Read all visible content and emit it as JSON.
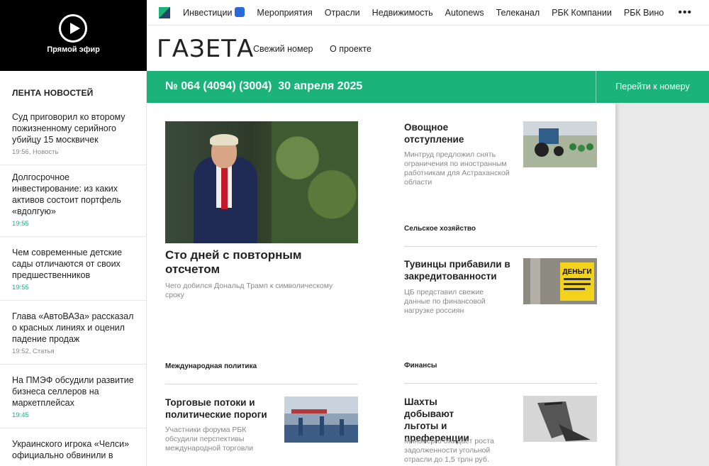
{
  "live": {
    "label": "Прямой эфир"
  },
  "feed": {
    "title": "ЛЕНТА НОВОСТЕЙ",
    "items": [
      {
        "title": "Суд приговорил ко второму пожизненному серийного убийцу 15 москвичек",
        "meta": "19:56, Новость"
      },
      {
        "title": "Долгосрочное инвестирование: из каких активов состоит портфель «вдолгую»",
        "meta": "19:55"
      },
      {
        "title": "Чем современные детские сады отличаются от своих предшественников",
        "meta": "19:55"
      },
      {
        "title": "Глава «АвтоВАЗа» рассказал о красных линиях и оценил падение продаж",
        "meta": "19:52, Статья"
      },
      {
        "title": "На ПМЭФ обсудили развитие бизнеса селлеров на маркетплейсах",
        "meta": "19:45"
      },
      {
        "title": "Украинского игрока «Челси» официально обвинили в",
        "meta": ""
      }
    ]
  },
  "nav": {
    "items": [
      "Инвестиции",
      "Мероприятия",
      "Отрасли",
      "Недвижимость",
      "Autonews",
      "Телеканал",
      "РБК Компании",
      "РБК Вино"
    ],
    "more": "•••"
  },
  "gazeta": {
    "title": "ГАЗЕТА",
    "links": [
      "Свежий номер",
      "О проекте"
    ]
  },
  "issue": {
    "title": "№ 064 (4094) (3004)  30 апреля 2025",
    "goto": "Перейти к номеру"
  },
  "main": {
    "headline": "Сто дней с повторным отсчетом",
    "subtitle": "Чего добился Дональд Трамп к символическому сроку"
  },
  "articles": {
    "a1": {
      "title": "Овощное отступление",
      "subtitle": "Минтруд предложил снять ограничения по иностранным работникам для Астраханской области"
    },
    "s_agri": "Сельское хозяйство",
    "a2": {
      "title": "Тувинцы прибавили в закредитованности",
      "subtitle": "ЦБ представил свежие данные по финансовой нагрузке россиян"
    },
    "s_intl": "Международная политика",
    "s_fin": "Финансы",
    "a3": {
      "title": "Торговые потоки и политические пороги",
      "subtitle": "Участники форума РБК обсудили перспективы международной торговли"
    },
    "a4": {
      "title": "Шахты добывают льготы и преференции",
      "subtitle": "Минэнерго ожидает роста задолженности угольной отрасли до 1,5 трлн руб."
    },
    "money_sign": "ДЕНЬГИ"
  }
}
